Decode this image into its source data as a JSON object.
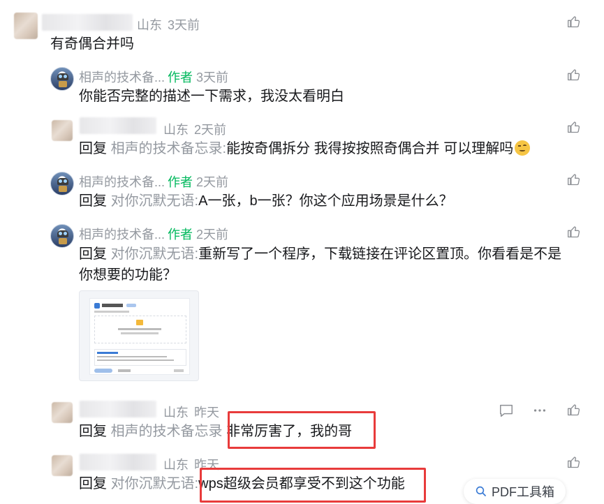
{
  "comments": [
    {
      "location": "山东",
      "time": "3天前",
      "text": "有奇偶合并吗"
    },
    {
      "name": "相声的技术备...",
      "badge": "作者",
      "time": "3天前",
      "text": "你能否完整的描述一下需求，我没太看明白"
    },
    {
      "location": "山东",
      "time": "2天前",
      "reply_label": "回复",
      "reply_target": "相声的技术备忘录:",
      "text": "能按奇偶拆分  我得按按照奇偶合并  可以理解吗"
    },
    {
      "name": "相声的技术备...",
      "badge": "作者",
      "time": "2天前",
      "reply_label": "回复",
      "reply_target": "对你沉默无语:",
      "text": "A一张，b一张？你这个应用场景是什么？"
    },
    {
      "name": "相声的技术备...",
      "badge": "作者",
      "time": "2天前",
      "reply_label": "回复",
      "reply_target": "对你沉默无语:",
      "text": "重新写了一个程序，下载链接在评论区置顶。你看看是不是",
      "text_line2": "你想要的功能？"
    },
    {
      "location": "山东",
      "time": "昨天",
      "reply_label": "回复",
      "reply_target": "相声的技术备忘录",
      "text": "非常厉害了，我的哥"
    },
    {
      "location": "山东",
      "time": "昨天",
      "reply_label": "回复",
      "reply_target": "对你沉默无语:",
      "text": "wps超级会员都享受不到这个功能"
    }
  ],
  "floating_button": {
    "label": "PDF工具箱",
    "icon": "search-icon"
  },
  "colors": {
    "highlight_box": "#e83b3b",
    "author_badge": "#00b85c",
    "muted": "#9499a0"
  }
}
